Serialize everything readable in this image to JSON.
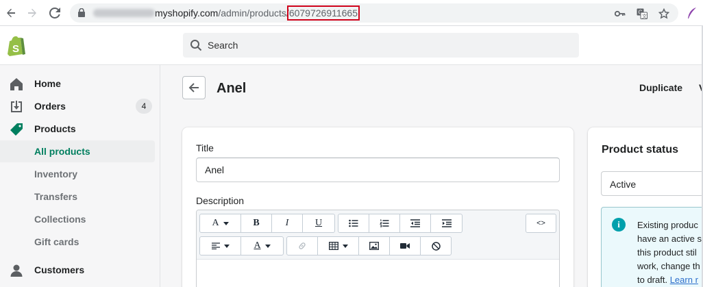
{
  "browser": {
    "url_domain": "myshopify.com",
    "url_path": "/admin/products/",
    "url_product_id": "6079726911665"
  },
  "topbar": {
    "search_placeholder": "Search"
  },
  "sidebar": {
    "items": [
      {
        "label": "Home",
        "icon": "home-icon"
      },
      {
        "label": "Orders",
        "icon": "orders-icon",
        "badge": "4"
      },
      {
        "label": "Products",
        "icon": "tag-icon"
      }
    ],
    "sub_items": [
      {
        "label": "All products",
        "selected": true
      },
      {
        "label": "Inventory"
      },
      {
        "label": "Transfers"
      },
      {
        "label": "Collections"
      },
      {
        "label": "Gift cards"
      }
    ],
    "customers": {
      "label": "Customers",
      "icon": "person-icon"
    }
  },
  "page": {
    "title": "Anel",
    "duplicate_label": "Duplicate",
    "view_label_partial": "V"
  },
  "form": {
    "title_label": "Title",
    "title_value": "Anel",
    "description_label": "Description",
    "toolbar": {
      "font_label": "A",
      "bold_label": "B",
      "italic_label": "I",
      "underline_label": "U",
      "align_label": "",
      "color_label": "A",
      "html_label": "<>"
    }
  },
  "status_card": {
    "title": "Product status",
    "selected": "Active",
    "banner_lines": [
      "Existing produc",
      "have an active s",
      "this product stil",
      "work, change th",
      "to draft."
    ],
    "banner_link": "Learn r"
  },
  "colors": {
    "accent_green": "#007f5f",
    "highlight_red": "#d0021b",
    "info_teal": "#00a0ac",
    "link_blue": "#2c6ecb"
  }
}
